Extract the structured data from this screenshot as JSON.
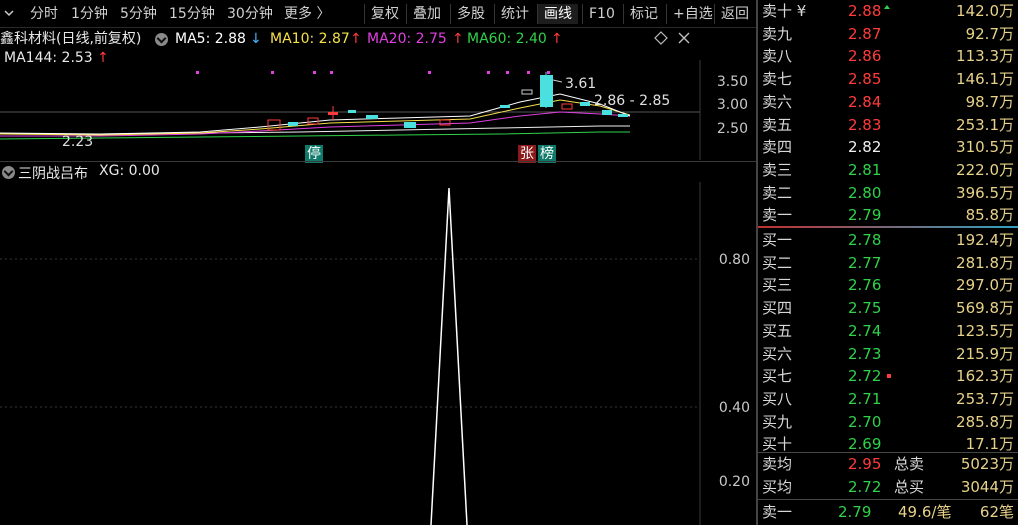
{
  "toolbar": {
    "tabs": [
      "分时",
      "1分钟",
      "5分钟",
      "15分钟",
      "30分钟",
      "更多 〉"
    ],
    "buttons": [
      "复权",
      "叠加",
      "多股",
      "统计",
      "画线",
      "F10",
      "标记",
      "+自选",
      "返回"
    ],
    "active_button": "画线"
  },
  "kline_header": {
    "title": "鑫科材料(日线,前复权)",
    "ma5": "MA5: 2.88",
    "ma5_arrow": "↓",
    "ma10": "MA10: 2.87",
    "ma10_arrow": "↑",
    "ma20": "MA20: 2.75",
    "ma20_arrow": "↑",
    "ma60": "MA60: 2.40",
    "ma60_arrow": "↑",
    "ma144": "MA144: 2.53",
    "ma144_arrow": "↑",
    "colors": {
      "ma5": "#ffffff",
      "ma10": "#f5e04a",
      "ma20": "#e040e0",
      "ma60": "#2fd24a",
      "arrow_up": "#ff3b3b",
      "arrow_down": "#4ab4ff"
    }
  },
  "kline_chart": {
    "y_ticks": [
      "3.50",
      "3.00",
      "2.50"
    ],
    "annotation_high": "3.61",
    "annotation_range": "2.86 - 2.85",
    "annotation_low": "2.23",
    "tag_stop": "停",
    "tag_zhang": "张",
    "tag_bang": "榜"
  },
  "indicator": {
    "name": "三阴战吕布",
    "xg": "XG: 0.00",
    "y_ticks": [
      "0.80",
      "0.40",
      "0.20"
    ]
  },
  "order_book": {
    "asks": [
      {
        "label": "卖十 ¥",
        "price": "2.88",
        "volume": "142.0万",
        "dir": "up"
      },
      {
        "label": "卖九",
        "price": "2.87",
        "volume": "92.7万",
        "dir": "up"
      },
      {
        "label": "卖八",
        "price": "2.86",
        "volume": "113.3万",
        "dir": "up"
      },
      {
        "label": "卖七",
        "price": "2.85",
        "volume": "146.1万",
        "dir": "up"
      },
      {
        "label": "卖六",
        "price": "2.84",
        "volume": "98.7万",
        "dir": "up"
      },
      {
        "label": "卖五",
        "price": "2.83",
        "volume": "253.1万",
        "dir": "up"
      },
      {
        "label": "卖四",
        "price": "2.82",
        "volume": "310.5万",
        "dir": "neutral"
      },
      {
        "label": "卖三",
        "price": "2.81",
        "volume": "222.0万",
        "dir": "down"
      },
      {
        "label": "卖二",
        "price": "2.80",
        "volume": "396.5万",
        "dir": "down"
      },
      {
        "label": "卖一",
        "price": "2.79",
        "volume": "85.8万",
        "dir": "down"
      }
    ],
    "bids": [
      {
        "label": "买一",
        "price": "2.78",
        "volume": "192.4万",
        "dir": "down"
      },
      {
        "label": "买二",
        "price": "2.77",
        "volume": "281.8万",
        "dir": "down"
      },
      {
        "label": "买三",
        "price": "2.76",
        "volume": "297.0万",
        "dir": "down"
      },
      {
        "label": "买四",
        "price": "2.75",
        "volume": "569.8万",
        "dir": "down"
      },
      {
        "label": "买五",
        "price": "2.74",
        "volume": "123.5万",
        "dir": "down"
      },
      {
        "label": "买六",
        "price": "2.73",
        "volume": "215.9万",
        "dir": "down"
      },
      {
        "label": "买七",
        "price": "2.72",
        "volume": "162.3万",
        "dir": "down"
      },
      {
        "label": "买八",
        "price": "2.71",
        "volume": "253.7万",
        "dir": "down"
      },
      {
        "label": "买九",
        "price": "2.70",
        "volume": "285.8万",
        "dir": "down"
      },
      {
        "label": "买十",
        "price": "2.69",
        "volume": "17.1万",
        "dir": "down"
      }
    ],
    "summary": {
      "avg_ask_label": "卖均",
      "avg_ask": "2.95",
      "total_ask_label": "总卖",
      "total_ask": "5023万",
      "avg_bid_label": "买均",
      "avg_bid": "2.72",
      "total_bid_label": "总买",
      "total_bid": "3044万"
    },
    "last_trade": {
      "label": "卖一",
      "price": "2.79",
      "amount": "49.6/笔",
      "count": "62笔"
    }
  }
}
